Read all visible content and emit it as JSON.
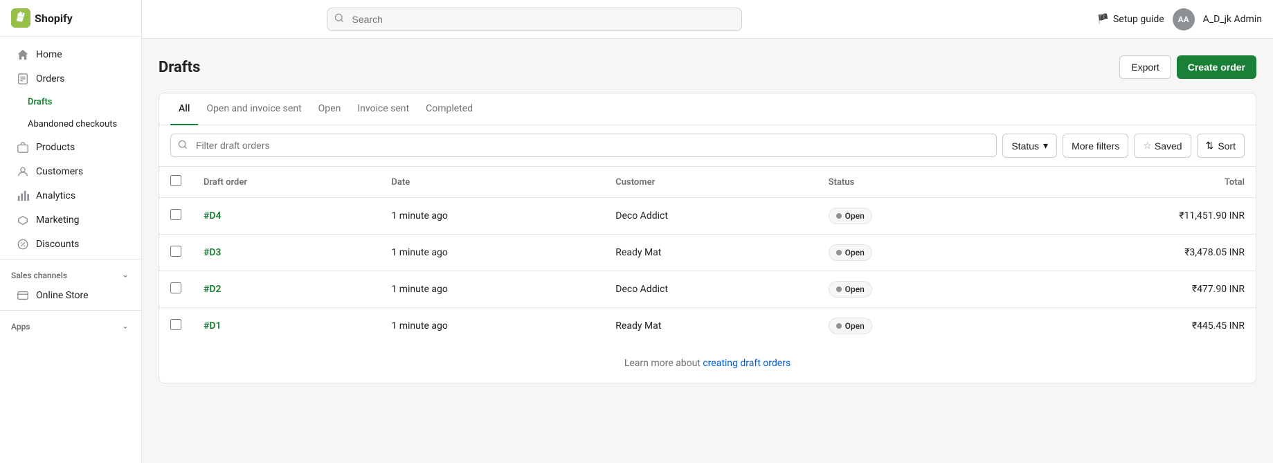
{
  "app": {
    "title": "Shopify"
  },
  "topbar": {
    "search_placeholder": "Search",
    "setup_guide_label": "Setup guide",
    "avatar_initials": "AA",
    "admin_name": "A_D_jk Admin"
  },
  "sidebar": {
    "items": [
      {
        "id": "home",
        "label": "Home",
        "icon": "home"
      },
      {
        "id": "orders",
        "label": "Orders",
        "icon": "orders",
        "expanded": true
      },
      {
        "id": "drafts",
        "label": "Drafts",
        "icon": null,
        "sub": true,
        "active": true
      },
      {
        "id": "abandoned-checkouts",
        "label": "Abandoned checkouts",
        "icon": null,
        "sub": true
      },
      {
        "id": "products",
        "label": "Products",
        "icon": "products"
      },
      {
        "id": "customers",
        "label": "Customers",
        "icon": "customers"
      },
      {
        "id": "analytics",
        "label": "Analytics",
        "icon": "analytics"
      },
      {
        "id": "marketing",
        "label": "Marketing",
        "icon": "marketing"
      },
      {
        "id": "discounts",
        "label": "Discounts",
        "icon": "discounts"
      }
    ],
    "sales_channels_label": "Sales channels",
    "sales_channels_items": [
      {
        "id": "online-store",
        "label": "Online Store",
        "icon": "store"
      }
    ],
    "apps_label": "Apps"
  },
  "page": {
    "title": "Drafts",
    "export_button": "Export",
    "create_order_button": "Create order"
  },
  "tabs": [
    {
      "id": "all",
      "label": "All",
      "active": true
    },
    {
      "id": "open-invoice-sent",
      "label": "Open and invoice sent",
      "active": false
    },
    {
      "id": "open",
      "label": "Open",
      "active": false
    },
    {
      "id": "invoice-sent",
      "label": "Invoice sent",
      "active": false
    },
    {
      "id": "completed",
      "label": "Completed",
      "active": false
    }
  ],
  "filters": {
    "search_placeholder": "Filter draft orders",
    "status_button": "Status",
    "more_filters_button": "More filters",
    "saved_button": "Saved",
    "sort_button": "Sort"
  },
  "table": {
    "columns": [
      {
        "id": "draft-order",
        "label": "Draft order"
      },
      {
        "id": "date",
        "label": "Date"
      },
      {
        "id": "customer",
        "label": "Customer"
      },
      {
        "id": "status",
        "label": "Status"
      },
      {
        "id": "total",
        "label": "Total",
        "align": "right"
      }
    ],
    "rows": [
      {
        "id": "d4",
        "draft_order": "#D4",
        "date": "1 minute ago",
        "customer": "Deco Addict",
        "status": "Open",
        "total": "₹11,451.90 INR"
      },
      {
        "id": "d3",
        "draft_order": "#D3",
        "date": "1 minute ago",
        "customer": "Ready Mat",
        "status": "Open",
        "total": "₹3,478.05 INR"
      },
      {
        "id": "d2",
        "draft_order": "#D2",
        "date": "1 minute ago",
        "customer": "Deco Addict",
        "status": "Open",
        "total": "₹477.90 INR"
      },
      {
        "id": "d1",
        "draft_order": "#D1",
        "date": "1 minute ago",
        "customer": "Ready Mat",
        "status": "Open",
        "total": "₹445.45 INR"
      }
    ]
  },
  "footer": {
    "text": "Learn more about ",
    "link_label": "creating draft orders",
    "link_url": "#"
  }
}
